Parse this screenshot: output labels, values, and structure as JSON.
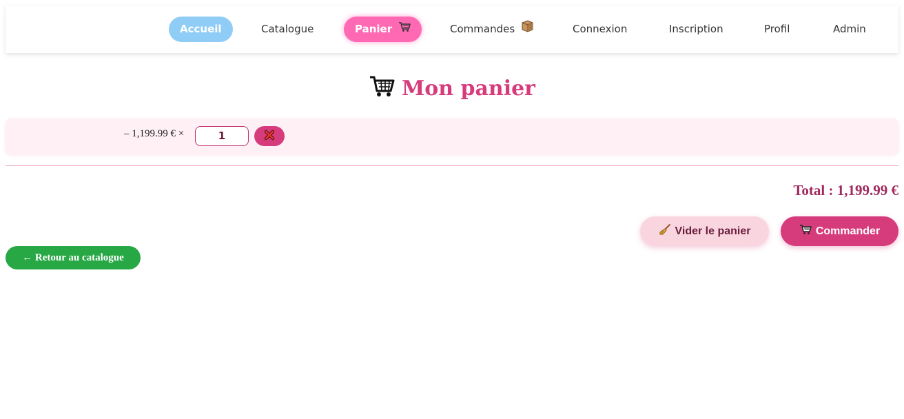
{
  "nav": {
    "items": [
      {
        "label": "Accueil",
        "icon": null
      },
      {
        "label": "Catalogue",
        "icon": null
      },
      {
        "label": "Panier",
        "icon": "cart-icon"
      },
      {
        "label": "Commandes",
        "icon": "package-icon"
      },
      {
        "label": "Connexion",
        "icon": null
      },
      {
        "label": "Inscription",
        "icon": null
      },
      {
        "label": "Profil",
        "icon": null
      },
      {
        "label": "Admin",
        "icon": null
      }
    ]
  },
  "page": {
    "title": "Mon panier",
    "title_icon": "cart-icon"
  },
  "cart": {
    "items": [
      {
        "price_text": "– 1,199.99 € ×",
        "quantity": "1",
        "remove_icon": "close-icon"
      }
    ]
  },
  "summary": {
    "total_text": "Total : 1,199.99 €"
  },
  "actions": {
    "clear_label": "Vider le panier",
    "clear_icon": "broom-icon",
    "order_label": "Commander",
    "order_icon": "cart-icon",
    "back_label": "← Retour au catalogue"
  },
  "colors": {
    "accent_pink": "#d63b7c",
    "nav_active_pink": "#ff69b4",
    "nav_home_blue": "#8fcdf6",
    "back_green": "#28a745"
  }
}
